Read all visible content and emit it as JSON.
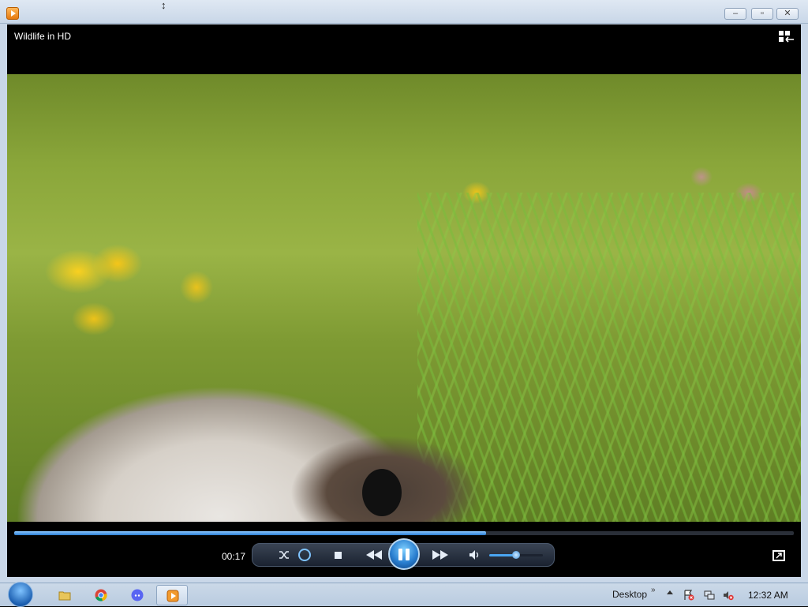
{
  "window": {
    "title": "Wildlife in HD"
  },
  "player": {
    "current_time": "00:17",
    "seek_progress": 0.605,
    "volume_level": 0.5,
    "state": "playing"
  },
  "icons": {
    "app": "wmp-icon",
    "switch_view": "switch-to-library-icon",
    "shuffle": "shuffle-icon",
    "repeat": "repeat-icon",
    "stop": "stop-icon",
    "previous": "previous-icon",
    "pause": "pause-icon",
    "next": "next-icon",
    "mute": "volume-icon",
    "fullscreen": "fullscreen-icon"
  },
  "taskbar": {
    "desktop_label": "Desktop",
    "chevron": "»",
    "clock": "12:32 AM",
    "apps": [
      "windows-explorer",
      "google-chrome",
      "discord",
      "windows-media-player"
    ]
  },
  "colors": {
    "accent": "#2a7ed4",
    "taskbar": "#c3d3e6",
    "player_bg": "#000000"
  }
}
